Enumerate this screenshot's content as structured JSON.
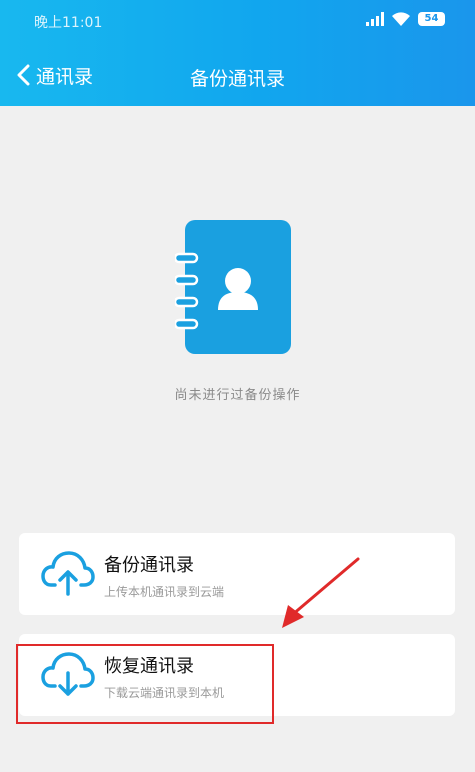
{
  "status_bar": {
    "time": "晚上11:01",
    "battery": "54",
    "icons": [
      "signal-icon",
      "wifi-icon",
      "battery-icon"
    ]
  },
  "nav": {
    "back_label": "通讯录",
    "title": "备份通讯录",
    "back_icon": "chevron-left-icon"
  },
  "empty_state": {
    "icon": "contact-book-icon",
    "message": "尚未进行过备份操作"
  },
  "actions": [
    {
      "icon": "cloud-upload-icon",
      "title": "备份通讯录",
      "subtitle": "上传本机通讯录到云端"
    },
    {
      "icon": "cloud-download-icon",
      "title": "恢复通讯录",
      "subtitle": "下载云端通讯录到本机"
    }
  ],
  "colors": {
    "header": "#13a9ee",
    "accent": "#1aa0e0",
    "annotation": "#e02a2a",
    "background": "#f0f0f0"
  }
}
